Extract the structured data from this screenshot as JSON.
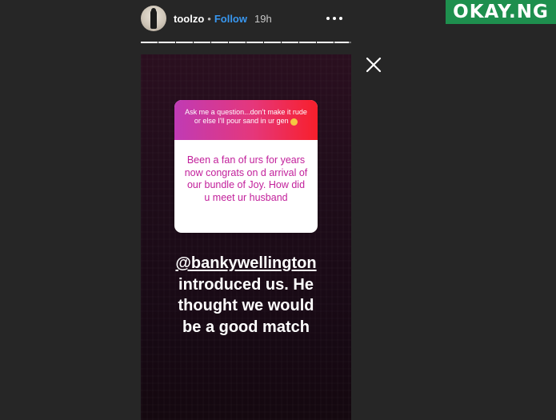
{
  "header": {
    "username": "toolzo",
    "separator": "•",
    "follow_label": "Follow",
    "time": "19h"
  },
  "story": {
    "segments_total": 12,
    "segments_done": 11,
    "active_progress": 0.85,
    "question": {
      "prompt": "Ask me a question...don't make it rude or else I'll pour sand in ur gen",
      "answer": "Been a fan of urs for years now congrats on d arrival of our bundle of Joy. How did u meet ur husband"
    },
    "reply": {
      "mention": "@bankywellington",
      "line1": "introduced us. He",
      "line2": "thought we would",
      "line3": "be a good match"
    }
  },
  "icons": {
    "close": "close-icon",
    "more": "more-options-icon"
  },
  "colors": {
    "follow": "#3897f0",
    "watermark_bg": "#1e8f4e",
    "question_text": "#c2209b"
  },
  "watermark": {
    "text": "OKAY.NG"
  }
}
